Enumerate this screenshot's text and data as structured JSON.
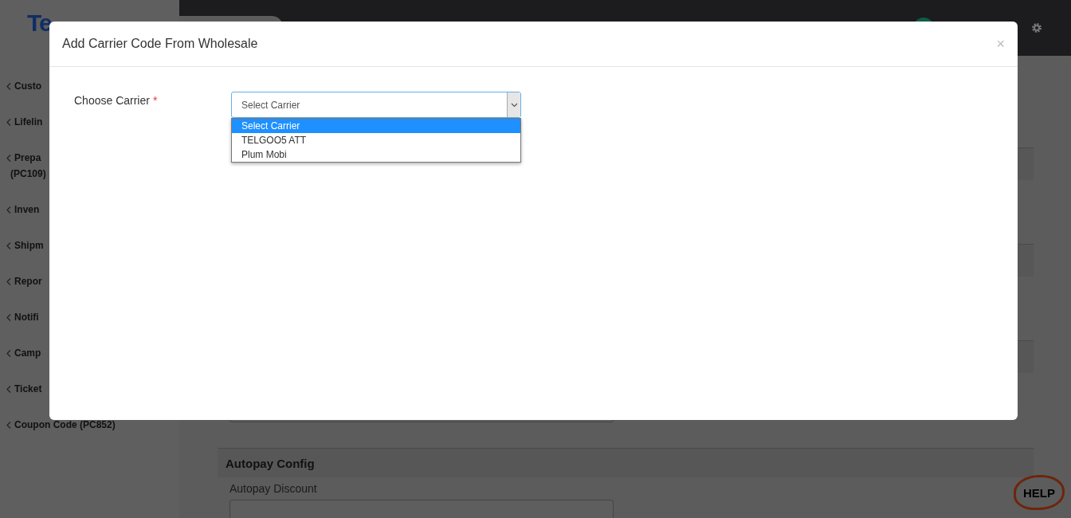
{
  "logo": {
    "left": "Te"
  },
  "sidebar": {
    "items": [
      {
        "label_lines": [
          "Custo"
        ]
      },
      {
        "label_lines": [
          "Lifelin"
        ]
      },
      {
        "label_lines": [
          "Prepa",
          "(PC109)"
        ]
      },
      {
        "label_lines": [
          "Inven"
        ]
      },
      {
        "label_lines": [
          "Shipm"
        ]
      },
      {
        "label_lines": [
          "Repor"
        ]
      },
      {
        "label_lines": [
          "Notifi"
        ]
      },
      {
        "label_lines": [
          "Camp"
        ]
      },
      {
        "label_lines": [
          "Ticket"
        ]
      },
      {
        "label_lines": [
          "Coupon Code (PC852)"
        ]
      }
    ]
  },
  "background_form": {
    "section_title": "Autopay Config",
    "field_label": "Autopay Discount"
  },
  "modal": {
    "title": "Add Carrier Code From Wholesale",
    "close": "×",
    "field": {
      "label": "Choose Carrier",
      "required_mark": "*",
      "value": "Select Carrier",
      "expanded": true,
      "options": [
        {
          "label": "Select Carrier",
          "selected": true
        },
        {
          "label": "TELGOO5 ATT",
          "selected": false
        },
        {
          "label": "Plum Mobi",
          "selected": false
        }
      ]
    }
  },
  "help_button": {
    "label": "HELP"
  }
}
